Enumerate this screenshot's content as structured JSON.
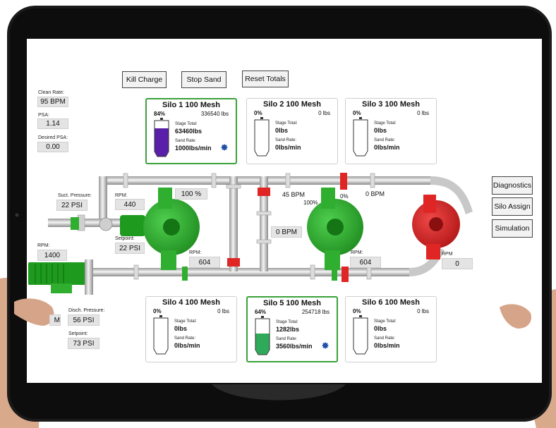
{
  "buttons": {
    "kill_charge": "Kill Charge",
    "stop_sand": "Stop Sand",
    "reset_totals": "Reset Totals",
    "diagnostics": "Diagnostics",
    "silo_assign": "Silo Assign",
    "simulation": "Simulation"
  },
  "left_panel": {
    "clean_rate_label": "Clean Rate:",
    "clean_rate_value": "95 BPM",
    "psa_label": "PSA:",
    "psa_value": "1.14",
    "desired_psa_label": "Desired PSA:",
    "desired_psa_value": "0.00"
  },
  "suction": {
    "pressure_label": "Suct. Pressure:",
    "pressure_value": "22 PSI",
    "rpm_label": "RPM:",
    "rpm_value": "440",
    "setpoint_label": "Setpoint:",
    "setpoint_value": "22 PSI",
    "motor_rpm_label": "RPM:",
    "motor_rpm_value": "1400"
  },
  "discharge": {
    "pressure_label": "Disch. Pressure:",
    "pressure_value": "56 PSI",
    "setpoint_label": "Setpoint:",
    "setpoint_value": "73 PSI",
    "partial_value": "M"
  },
  "pumps": {
    "pump1_pct": "100 %",
    "pump1_rpm_label": "RPM:",
    "pump1_rpm_value": "604",
    "pump2_rpm_label": "RPM:",
    "pump2_rpm_value": "604",
    "pump3_rpm_label": "RPM",
    "pump3_rpm_value": "0"
  },
  "flows": {
    "bpm_45": "45 BPM",
    "valve_100": "100%",
    "valve_0": "0%",
    "bpm_right": "0 BPM",
    "bpm_middle": "0 BPM"
  },
  "silos": [
    {
      "title": "Silo 1 100 Mesh",
      "pct": "84%",
      "lbs": "336540 lbs",
      "stage_label": "Stage Total:",
      "stage_value": "63460lbs",
      "rate_label": "Sand Rate:",
      "rate_value": "1000lbs/min",
      "fill": 0.84,
      "color": "#5a1fa8",
      "active": true,
      "gear": true
    },
    {
      "title": "Silo 2 100 Mesh",
      "pct": "0%",
      "lbs": "0 lbs",
      "stage_label": "Stage Total:",
      "stage_value": "0lbs",
      "rate_label": "Sand Rate:",
      "rate_value": "0lbs/min",
      "fill": 0,
      "color": "#ffffff",
      "active": false,
      "gear": false
    },
    {
      "title": "Silo 3 100 Mesh",
      "pct": "0%",
      "lbs": "0 lbs",
      "stage_label": "Stage Total:",
      "stage_value": "0lbs",
      "rate_label": "Sand Rate:",
      "rate_value": "0lbs/min",
      "fill": 0,
      "color": "#ffffff",
      "active": false,
      "gear": false
    },
    {
      "title": "Silo 4 100 Mesh",
      "pct": "0%",
      "lbs": "0 lbs",
      "stage_label": "Stage Total:",
      "stage_value": "0lbs",
      "rate_label": "Sand Rate:",
      "rate_value": "0lbs/min",
      "fill": 0,
      "color": "#ffffff",
      "active": false,
      "gear": false
    },
    {
      "title": "Silo 5 100 Mesh",
      "pct": "64%",
      "lbs": "254718 lbs",
      "stage_label": "Stage Total:",
      "stage_value": "1282lbs",
      "rate_label": "Sand Rate:",
      "rate_value": "3560lbs/min",
      "fill": 0.64,
      "color": "#2faa5a",
      "active": true,
      "gear": true
    },
    {
      "title": "Silo 6 100 Mesh",
      "pct": "0%",
      "lbs": "0 lbs",
      "stage_label": "Stage Total:",
      "stage_value": "0lbs",
      "rate_label": "Sand Rate:",
      "rate_value": "0lbs/min",
      "fill": 0,
      "color": "#ffffff",
      "active": false,
      "gear": false
    }
  ],
  "colors": {
    "running": "#2fae2f",
    "stopped": "#e02525",
    "active_border": "#3aa13a",
    "gear": "#1f4fa8"
  },
  "icons": [
    "gear-icon",
    "pump-icon",
    "valve-icon",
    "motor-icon"
  ]
}
